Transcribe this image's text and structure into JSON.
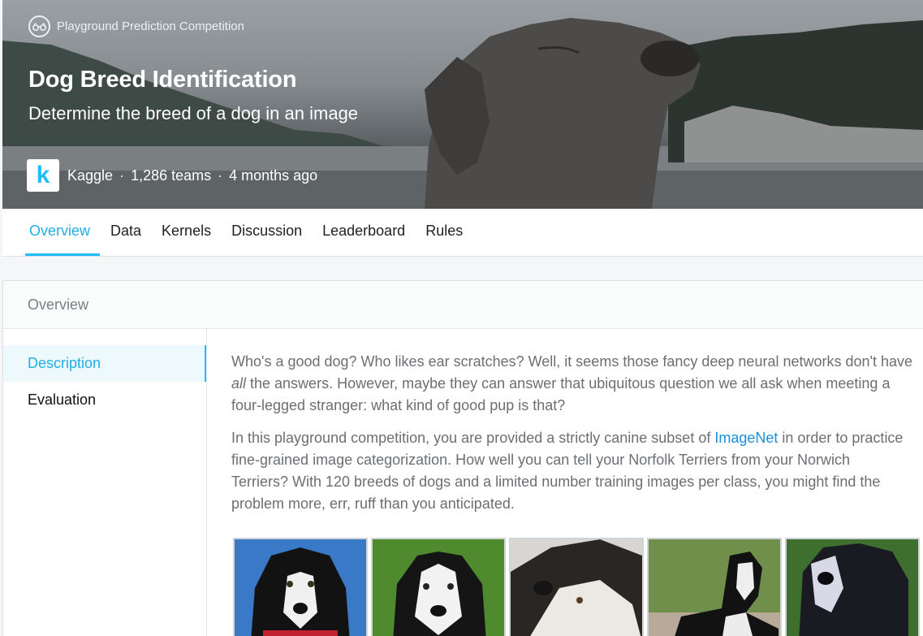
{
  "hero": {
    "competition_type": "Playground Prediction Competition",
    "title": "Dog Breed Identification",
    "subtitle": "Determine the breed of a dog in an image",
    "host_logo_letter": "k",
    "host": "Kaggle",
    "teams": "1,286 teams",
    "time_ago": "4 months ago",
    "separator": "·"
  },
  "tabs": [
    {
      "label": "Overview",
      "active": true
    },
    {
      "label": "Data"
    },
    {
      "label": "Kernels"
    },
    {
      "label": "Discussion"
    },
    {
      "label": "Leaderboard"
    },
    {
      "label": "Rules"
    }
  ],
  "card": {
    "header": "Overview",
    "sidenav": [
      {
        "label": "Description",
        "active": true
      },
      {
        "label": "Evaluation"
      }
    ],
    "description": {
      "p1_line1": "Who's a good dog? Who likes ear scratches? Well, it seems those fancy deep neural networks don't have",
      "p1_em": "all",
      "p1_line2_rest": " the answers. However, maybe they can answer that ubiquitous question we all ask when meeting a",
      "p1_line3": "four-legged stranger: what kind of good pup is that?",
      "p2_line1_pre": "In this playground competition, you are provided a strictly canine subset of ",
      "p2_link": "ImageNet",
      "p2_line1_post": " in order to practice",
      "p2_line2": "fine-grained image categorization. How well you can tell your Norfolk Terriers from your Norwich",
      "p2_line3": "Terriers? With 120 breeds of dogs and a limited number training images per class, you might find the",
      "p2_line4": "problem more, err, ruff than you anticipated."
    }
  },
  "colors": {
    "accent": "#20beff",
    "link": "#1a8fd8",
    "body_text": "#6b6f73"
  },
  "icons": {
    "competition_type": "binoculars-icon"
  }
}
